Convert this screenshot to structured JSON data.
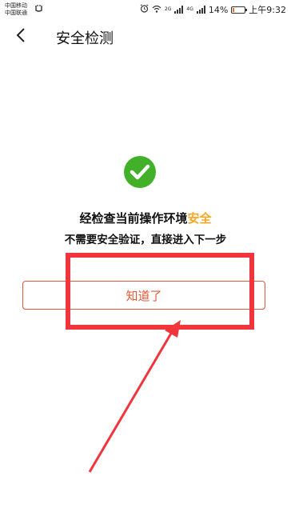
{
  "status_bar": {
    "carrier_1": "中国移动",
    "carrier_2": "中国联通",
    "network_tag_1": "2G",
    "network_tag_2": "4G",
    "battery_percent": "14%",
    "battery_level": 0.14,
    "time": "上午9:32",
    "icons": [
      "carrier-badge-icon",
      "alarm-icon",
      "wifi-icon",
      "signal-icon",
      "signal-icon",
      "battery-icon"
    ]
  },
  "header": {
    "back_icon": "chevron-left-icon",
    "title": "安全检测"
  },
  "result": {
    "icon": "check-circle-icon",
    "line1_prefix": "经检查当前操作环境",
    "line1_highlight": "安全",
    "line2": "不需要安全验证，直接进入下一步"
  },
  "actions": {
    "confirm_label": "知道了"
  },
  "colors": {
    "accent_orange": "#f5a623",
    "success_green": "#43b02a",
    "button_red": "#e05a3a",
    "annotation_red": "#f0353d"
  }
}
